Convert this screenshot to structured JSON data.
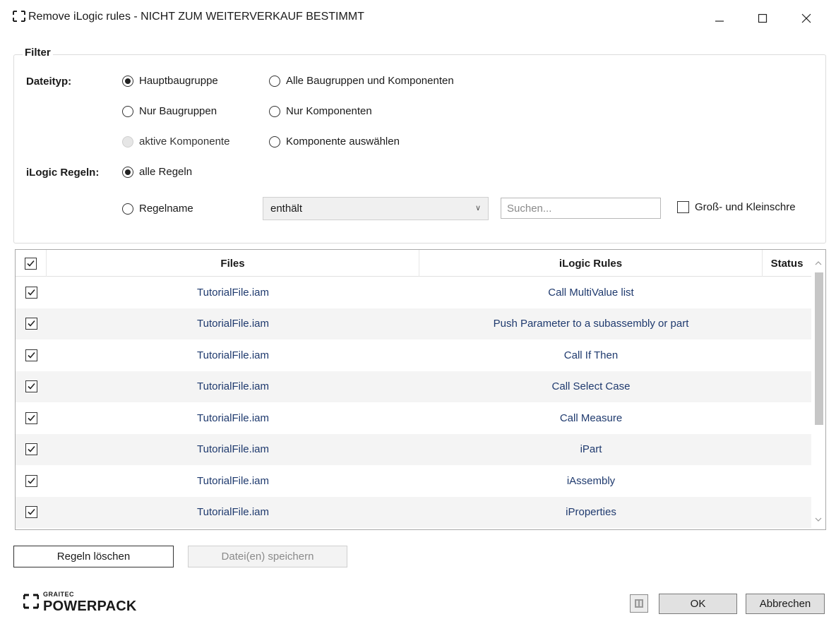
{
  "window": {
    "title": "Remove iLogic rules - NICHT ZUM WEITERVERKAUF BESTIMMT",
    "app_icon": "graitec-bracket-icon"
  },
  "filter": {
    "legend": "Filter",
    "dateityp_label": "Dateityp:",
    "dateityp_options": [
      {
        "label": "Hauptbaugruppe",
        "checked": true,
        "enabled": true
      },
      {
        "label": "Alle Baugruppen und Komponenten",
        "checked": false,
        "enabled": true
      },
      {
        "label": "Nur Baugruppen",
        "checked": false,
        "enabled": true
      },
      {
        "label": "Nur Komponenten",
        "checked": false,
        "enabled": true
      },
      {
        "label": "aktive Komponente",
        "checked": false,
        "enabled": false
      },
      {
        "label": "Komponente auswählen",
        "checked": false,
        "enabled": true
      }
    ],
    "regeln_label": "iLogic Regeln:",
    "regeln_options": [
      {
        "label": "alle Regeln",
        "checked": true
      },
      {
        "label": "Regelname",
        "checked": false
      }
    ],
    "match_select": "enthält",
    "search_placeholder": "Suchen...",
    "case_sensitive_label": "Groß- und Kleinschre",
    "case_sensitive_checked": false
  },
  "grid": {
    "columns": [
      "Files",
      "iLogic Rules",
      "Status"
    ],
    "header_checked": true,
    "rows": [
      {
        "checked": true,
        "file": "TutorialFile.iam",
        "rule": "Call MultiValue list",
        "status": ""
      },
      {
        "checked": true,
        "file": "TutorialFile.iam",
        "rule": "Push Parameter to a subassembly or part",
        "status": ""
      },
      {
        "checked": true,
        "file": "TutorialFile.iam",
        "rule": "Call If Then",
        "status": ""
      },
      {
        "checked": true,
        "file": "TutorialFile.iam",
        "rule": "Call Select Case",
        "status": ""
      },
      {
        "checked": true,
        "file": "TutorialFile.iam",
        "rule": "Call Measure",
        "status": ""
      },
      {
        "checked": true,
        "file": "TutorialFile.iam",
        "rule": "iPart",
        "status": ""
      },
      {
        "checked": true,
        "file": "TutorialFile.iam",
        "rule": "iAssembly",
        "status": ""
      },
      {
        "checked": true,
        "file": "TutorialFile.iam",
        "rule": "iProperties",
        "status": ""
      }
    ]
  },
  "actions": {
    "delete_rules": "Regeln löschen",
    "save_files": "Datei(en) speichern",
    "ok": "OK",
    "cancel": "Abbrechen",
    "help_icon": "book-help-icon"
  },
  "branding": {
    "logo_small": "GRAITEC",
    "logo_big": "POWERPACK"
  },
  "colors": {
    "cell_text": "#1f3a6e",
    "row_alt": "#f4f4f4",
    "disabled_text": "#8a8a8a"
  }
}
